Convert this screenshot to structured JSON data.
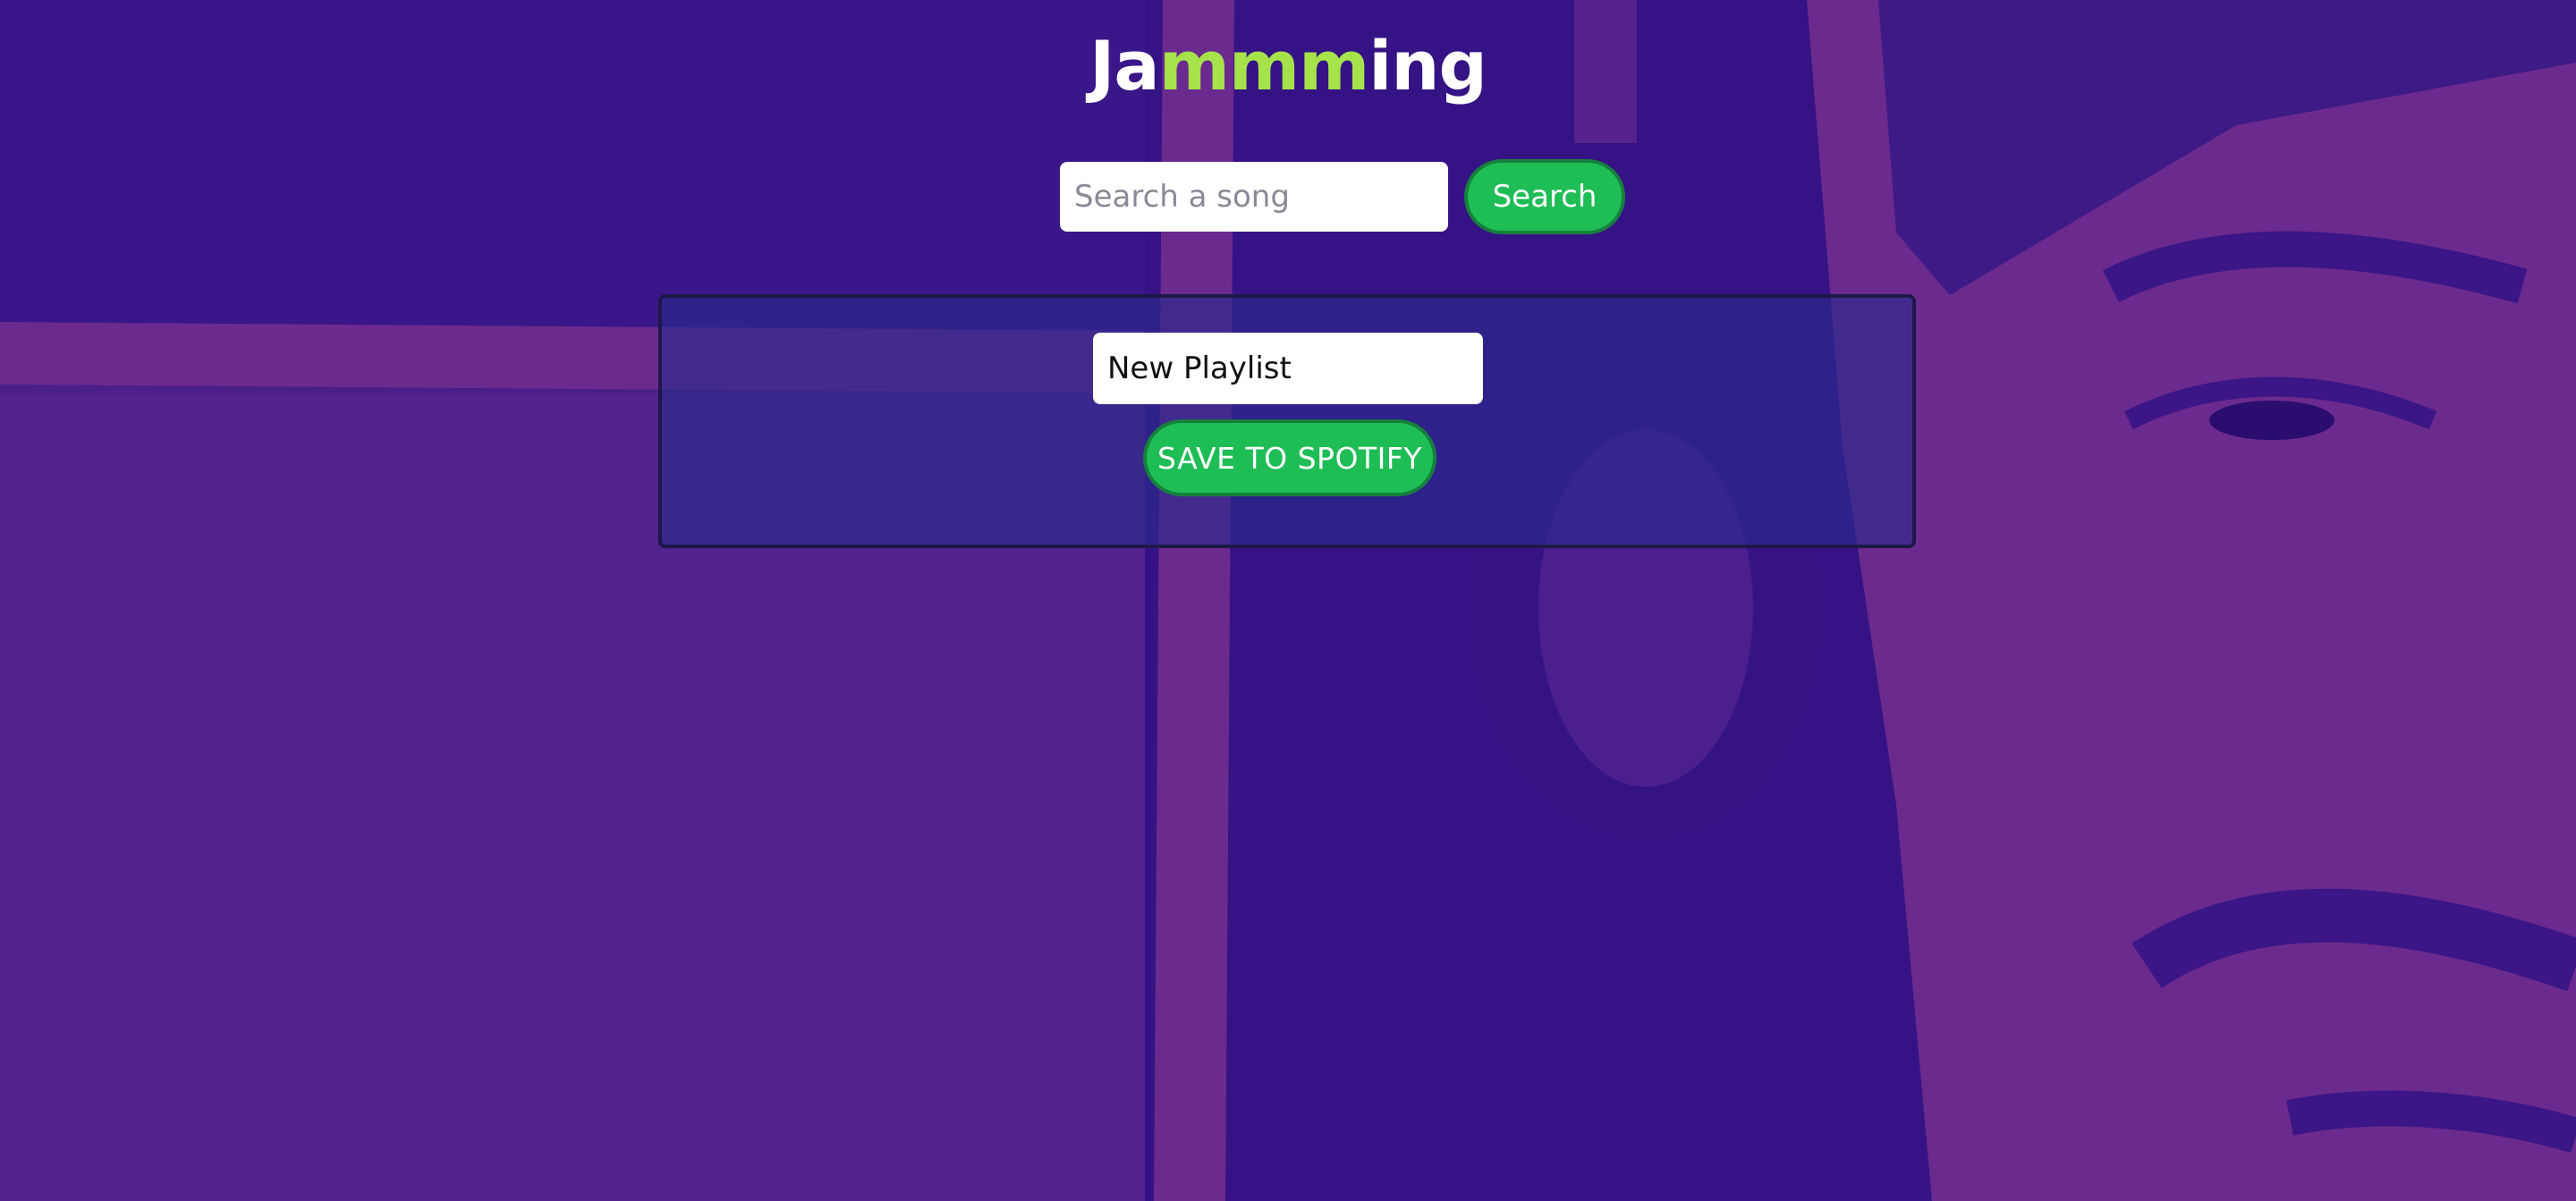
{
  "app": {
    "title_prefix": "Ja",
    "title_accent": "mmm",
    "title_suffix": "ing",
    "accent_color": "#a6e24a"
  },
  "search": {
    "placeholder": "Search a song",
    "value": "",
    "button_label": "Search"
  },
  "playlist": {
    "name_value": "New Playlist",
    "save_label": "SAVE TO SPOTIFY"
  },
  "colors": {
    "background": "#351384",
    "background_highlight": "#6b2a8e",
    "button_green": "#1fbd55",
    "button_border": "#15803d",
    "panel_fill": "rgba(42, 42, 140, 0.62)"
  },
  "icons": {
    "background_image": "dj-with-headphones-photo"
  }
}
